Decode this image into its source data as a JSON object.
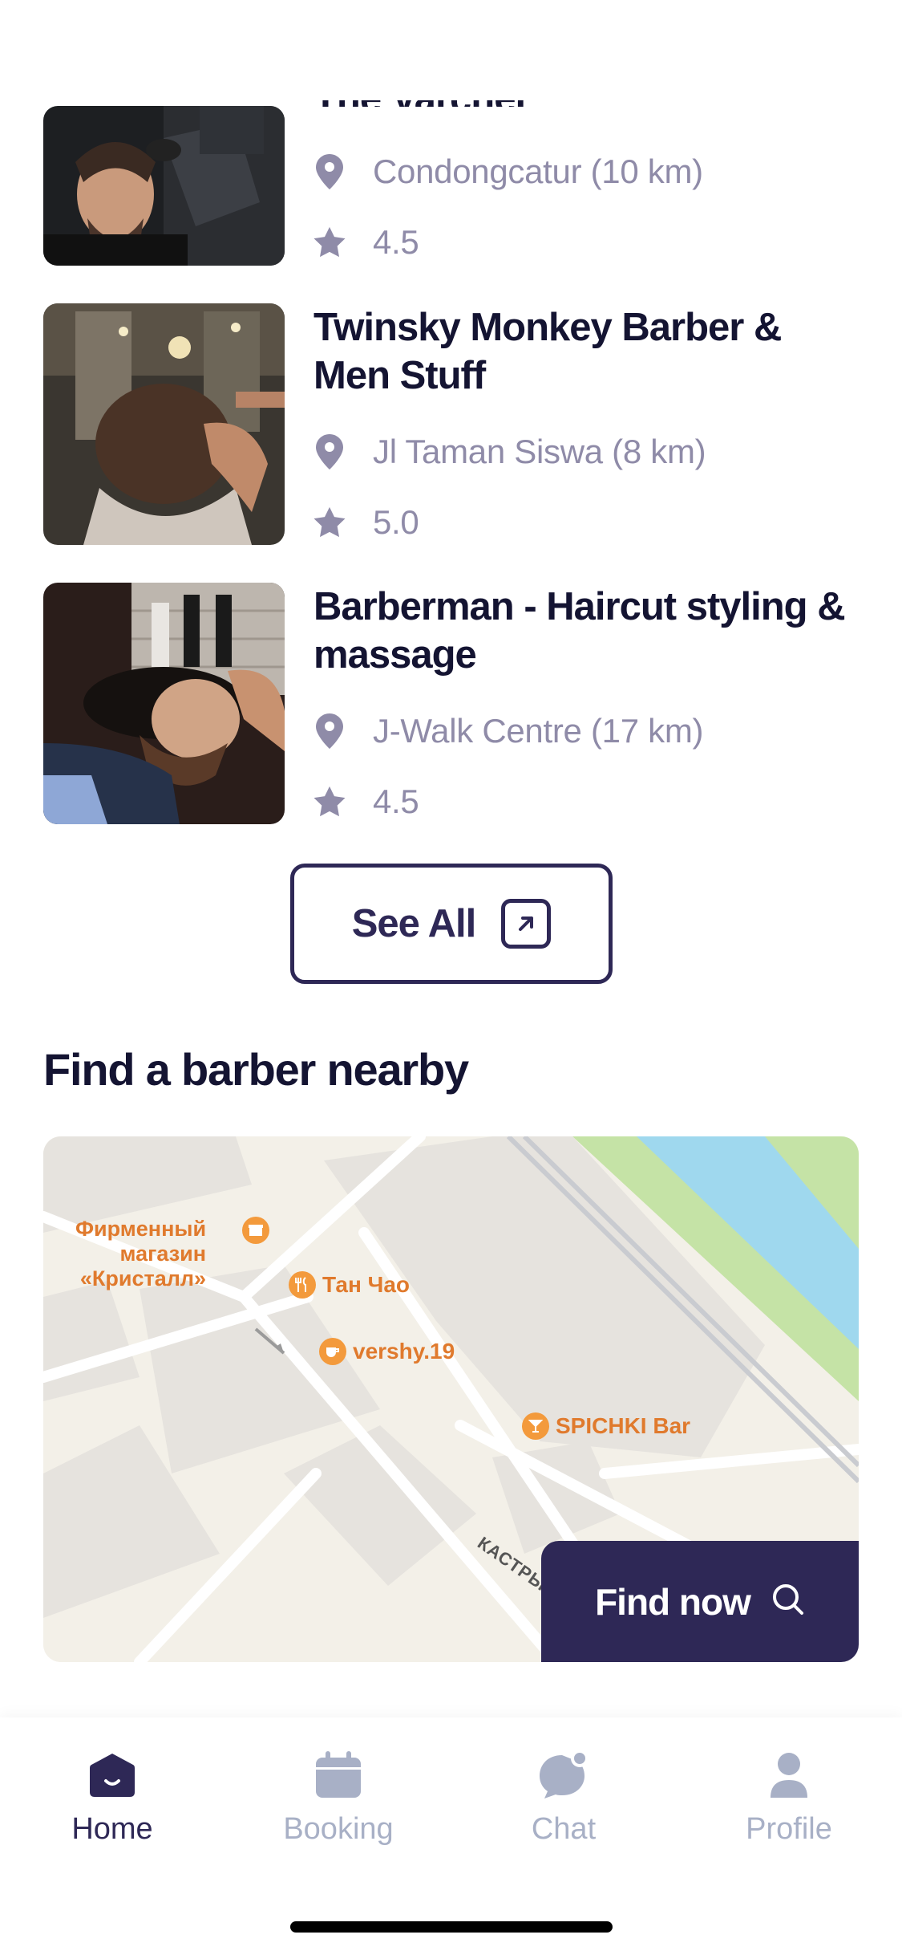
{
  "shops": [
    {
      "name": "The Varcher",
      "location": "Condongcatur (10 km)",
      "rating": "4.5"
    },
    {
      "name": "Twinsky Monkey Barber & Men Stuff",
      "location": "Jl Taman Siswa (8 km)",
      "rating": "5.0"
    },
    {
      "name": "Barberman - Haircut styling & massage",
      "location": "J-Walk Centre (17 km)",
      "rating": "4.5"
    }
  ],
  "see_all_label": "See All",
  "nearby_title": "Find a barber nearby",
  "map": {
    "pois": {
      "store": "Фирменный\nмагазин\n«Кристалл»",
      "tan_chao": "Тан Чао",
      "vershy": "vershy.19",
      "spichki": "SPICHKI Bar"
    },
    "street": "КАСТРЫ"
  },
  "find_now_label": "Find now",
  "tabs": [
    {
      "label": "Home",
      "icon": "home-icon",
      "active": true
    },
    {
      "label": "Booking",
      "icon": "calendar-icon",
      "active": false
    },
    {
      "label": "Chat",
      "icon": "chat-icon",
      "active": false
    },
    {
      "label": "Profile",
      "icon": "profile-icon",
      "active": false
    }
  ],
  "colors": {
    "primary": "#2e2856",
    "muted": "#8f8ba8",
    "tab_inactive": "#a8b0c6"
  }
}
